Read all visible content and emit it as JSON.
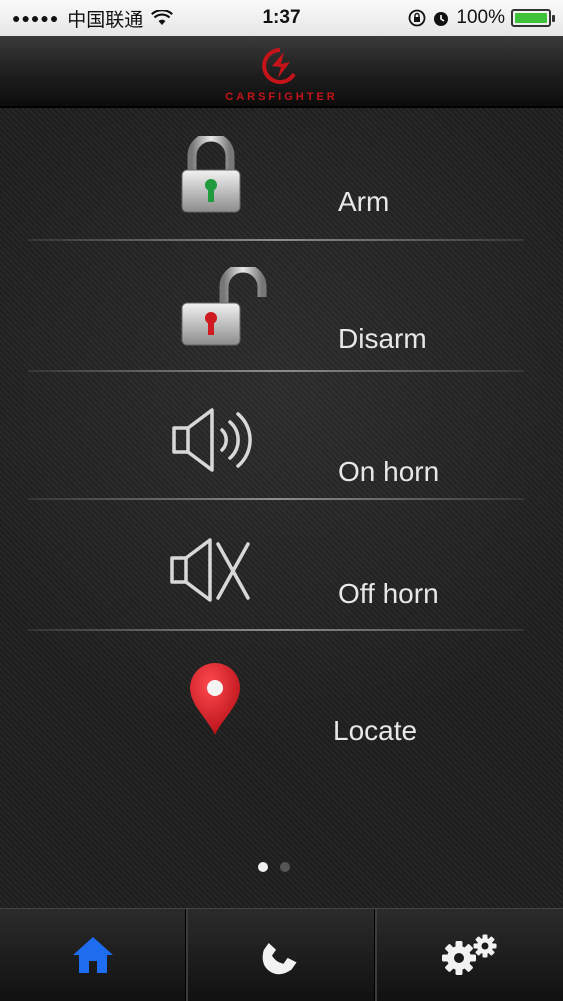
{
  "status_bar": {
    "carrier": "中国联通",
    "time": "1:37",
    "battery": "100%"
  },
  "header": {
    "brand": "CARSFIGHTER"
  },
  "actions": [
    {
      "label": "Arm",
      "icon": "lock-closed-icon"
    },
    {
      "label": "Disarm",
      "icon": "lock-open-icon"
    },
    {
      "label": "On horn",
      "icon": "speaker-on-icon"
    },
    {
      "label": "Off horn",
      "icon": "speaker-off-icon"
    },
    {
      "label": "Locate",
      "icon": "map-pin-icon"
    }
  ],
  "pager": {
    "current": 1,
    "total": 2
  },
  "tabs": [
    {
      "icon": "home-icon",
      "active": true
    },
    {
      "icon": "phone-icon",
      "active": false
    },
    {
      "icon": "settings-gears-icon",
      "active": false
    }
  ],
  "colors": {
    "brand_red": "#c4141a",
    "active_tab": "#1e6cf0",
    "battery_green": "#3ec23a",
    "arm_key_green": "#1f9a3c",
    "disarm_key_red": "#d01a22",
    "pin_red": "#e3121a"
  }
}
